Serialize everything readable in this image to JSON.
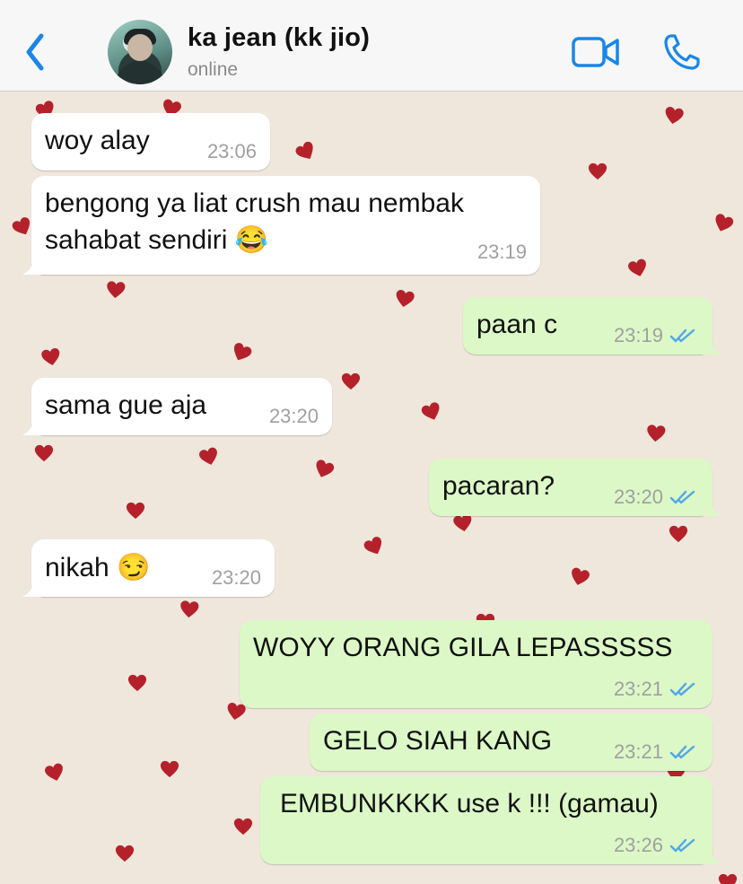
{
  "header": {
    "contact_name": "ka jean (kk jio)",
    "contact_status": "online"
  },
  "colors": {
    "incoming_bubble": "#ffffff",
    "outgoing_bubble": "#dcf8c6",
    "accent": "#1a86e8",
    "heart": "#b5212b",
    "read_ticks": "#4fa7e8"
  },
  "icons": {
    "back": "chevron-left-icon",
    "video": "video-camera-icon",
    "call": "phone-icon",
    "read": "double-check-icon"
  },
  "messages": [
    {
      "direction": "incoming",
      "lines": [
        "woy alay"
      ],
      "time": "23:06"
    },
    {
      "direction": "incoming",
      "lines": [
        "bengong ya liat crush mau nembak",
        "sahabat sendiri 😂"
      ],
      "time": "23:19"
    },
    {
      "direction": "outgoing",
      "lines": [
        "paan c"
      ],
      "time": "23:19",
      "read": true
    },
    {
      "direction": "incoming",
      "lines": [
        "sama gue aja"
      ],
      "time": "23:20"
    },
    {
      "direction": "outgoing",
      "lines": [
        "pacaran?"
      ],
      "time": "23:20",
      "read": true
    },
    {
      "direction": "incoming",
      "lines": [
        "nikah 😏"
      ],
      "time": "23:20"
    },
    {
      "direction": "outgoing",
      "lines": [
        "WOYY ORANG GILA LEPASSSSS"
      ],
      "time": "23:21",
      "read": true
    },
    {
      "direction": "outgoing",
      "lines": [
        "GELO SIAH KANG"
      ],
      "time": "23:21",
      "read": true
    },
    {
      "direction": "outgoing",
      "lines": [
        "EMBUNKKKK use k !!! (gamau)"
      ],
      "time": "23:26",
      "read": true
    }
  ]
}
